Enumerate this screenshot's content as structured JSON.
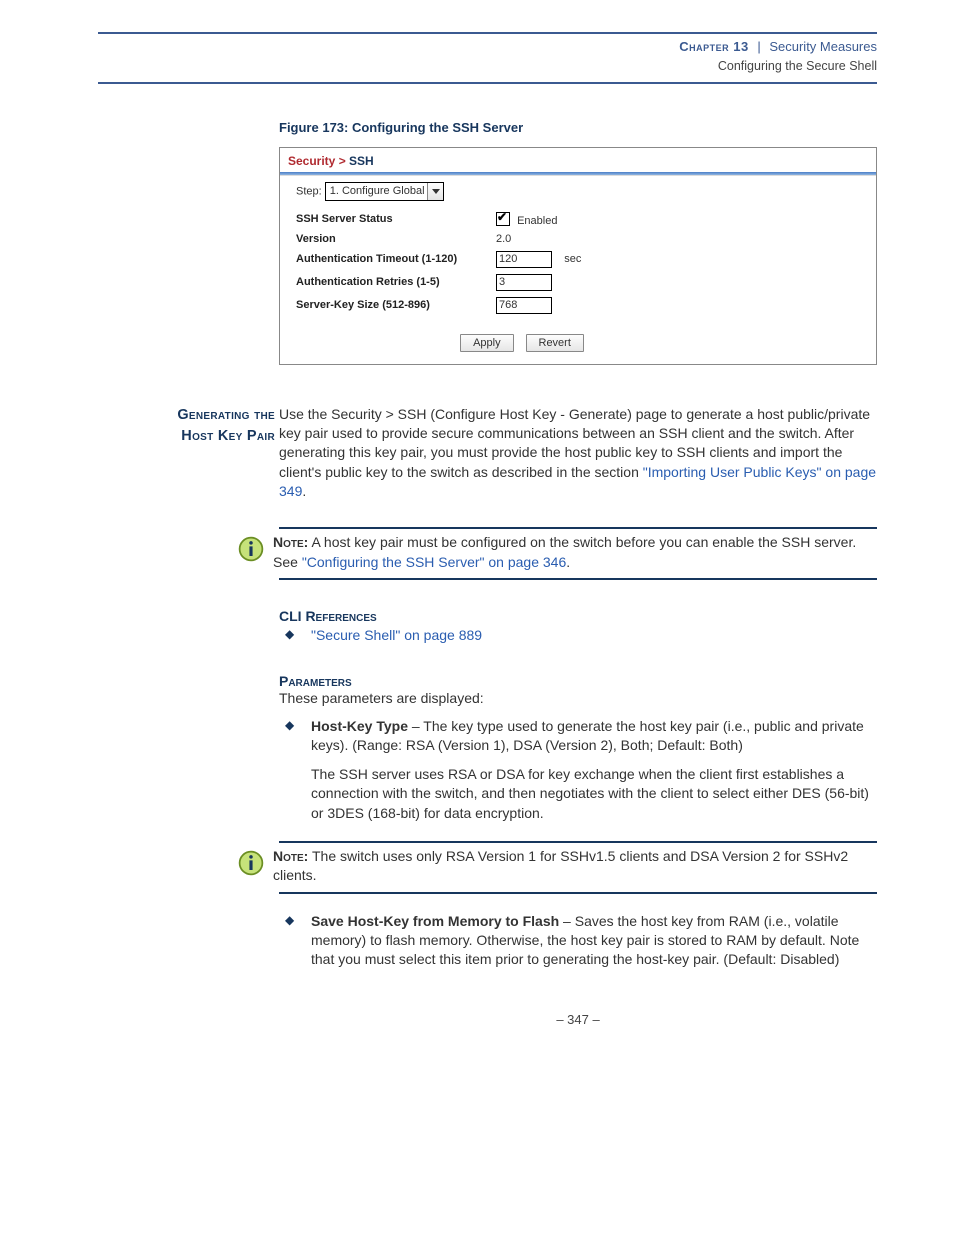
{
  "header": {
    "chapter": "Chapter 13",
    "sep": "|",
    "section": "Security Measures",
    "subsection": "Configuring the Secure Shell"
  },
  "figure": {
    "caption": "Figure 173:  Configuring the SSH Server"
  },
  "screenshot": {
    "breadcrumb_root": "Security >",
    "breadcrumb_leaf": "SSH",
    "step_label": "Step:",
    "step_value": "1. Configure Global",
    "rows": {
      "status_label": "SSH Server Status",
      "status_enabled": "Enabled",
      "version_label": "Version",
      "version_value": "2.0",
      "timeout_label": "Authentication Timeout (1-120)",
      "timeout_value": "120",
      "timeout_unit": "sec",
      "retries_label": "Authentication Retries (1-5)",
      "retries_value": "3",
      "keysize_label": "Server-Key Size (512-896)",
      "keysize_value": "768"
    },
    "apply_btn": "Apply",
    "revert_btn": "Revert"
  },
  "sidehead1": "Generating the",
  "sidehead2": "Host Key Pair",
  "intro_para_pre": "Use the Security > SSH (Configure Host Key - Generate) page to generate a host public/private key pair used to provide secure communications between an SSH client and the switch. After generating this key pair, you must provide the host public key to SSH clients and import the client's public key to the switch as described in the section ",
  "intro_link": "\"Importing User Public Keys\" on page 349",
  "intro_period": ".",
  "note1_label": "Note:",
  "note1_text_pre": " A host key pair must be configured on the switch before you can enable the SSH server. See ",
  "note1_link": "\"Configuring the SSH Server\" on page 346",
  "note1_period": ".",
  "cli_head": "CLI References",
  "cli_link": "\"Secure Shell\" on page 889",
  "params_head": "Parameters",
  "params_intro": "These parameters are displayed:",
  "param1_bold": "Host-Key Type",
  "param1_text": " – The key type used to generate the host key pair (i.e., public and private keys). (Range: RSA (Version 1), DSA (Version 2), Both; Default: Both)",
  "param1_sub": "The SSH server uses RSA or DSA for key exchange when the client first establishes a connection with the switch, and then negotiates with the client to select either DES (56-bit) or 3DES (168-bit) for data encryption.",
  "note2_label": "Note:",
  "note2_text": " The switch uses only RSA Version 1 for SSHv1.5 clients and DSA Version 2 for SSHv2 clients.",
  "param2_bold": "Save Host-Key from Memory to Flash",
  "param2_text": " – Saves the host key from RAM (i.e., volatile memory) to flash memory. Otherwise, the host key pair is stored to RAM by default. Note that you must select this item prior to generating the host-key pair. (Default: Disabled)",
  "pagenum": "–  347  –"
}
